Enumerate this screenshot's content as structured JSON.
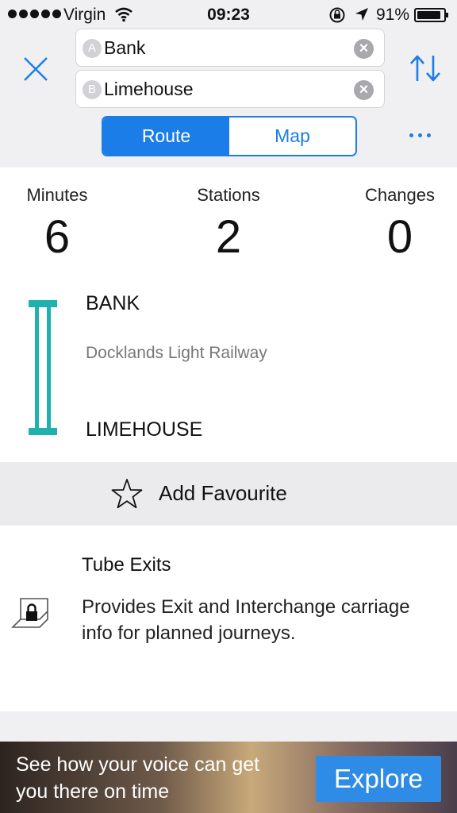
{
  "status_bar": {
    "carrier": "Virgin",
    "time": "09:23",
    "battery": "91%",
    "battery_level": 0.91
  },
  "journey": {
    "from_badge": "A",
    "from": "Bank",
    "to_badge": "B",
    "to": "Limehouse",
    "tabs": [
      {
        "label": "Route",
        "active": true
      },
      {
        "label": "Map",
        "active": false
      }
    ]
  },
  "summary": {
    "minutes_label": "Minutes",
    "minutes": "6",
    "stations_label": "Stations",
    "stations": "2",
    "changes_label": "Changes",
    "changes": "0"
  },
  "route": {
    "from_stop": "BANK",
    "line": "Docklands Light Railway",
    "to_stop": "LIMEHOUSE",
    "line_color": "#1eb1ad"
  },
  "favourite": {
    "label": "Add Favourite"
  },
  "promo": {
    "title": "Tube Exits",
    "description": "Provides Exit and Interchange carriage info for planned journeys."
  },
  "ad": {
    "text": "See how your voice can get you there on time",
    "cta": "Explore"
  },
  "colors": {
    "accent": "#1a7de8",
    "dlr": "#1eb1ad"
  }
}
